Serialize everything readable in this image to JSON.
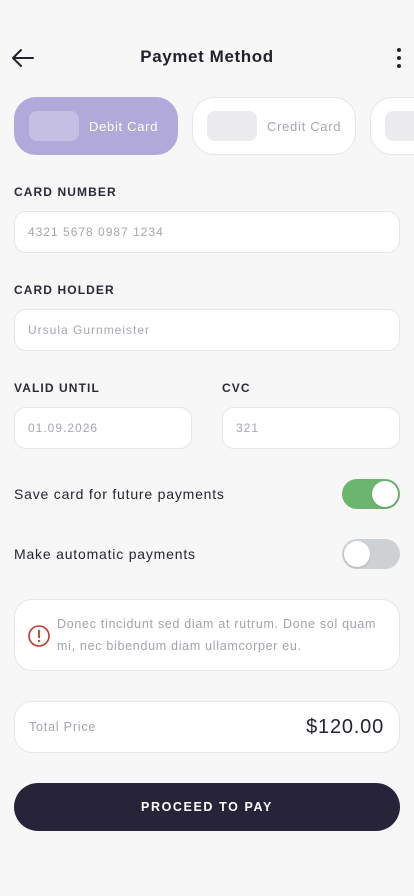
{
  "header": {
    "title": "Paymet Method"
  },
  "tabs": [
    {
      "label": "Debit Card",
      "active": true
    },
    {
      "label": "Credit Card",
      "active": false
    },
    {
      "label": "",
      "active": false
    }
  ],
  "form": {
    "card_number_label": "CARD NUMBER",
    "card_number_value": "4321 5678 0987 1234",
    "card_holder_label": "CARD HOLDER",
    "card_holder_value": "Ursula Gurnmeister",
    "valid_until_label": "VALID UNTIL",
    "valid_until_value": "01.09.2026",
    "cvc_label": "CVC",
    "cvc_value": "321"
  },
  "toggles": {
    "save_card_label": "Save card for future payments",
    "save_card_on": true,
    "auto_pay_label": "Make automatic payments",
    "auto_pay_on": false
  },
  "info": {
    "icon": "alert-circle-icon",
    "text": "Donec tincidunt sed diam at rutrum. Done sol quam mi, nec bibendum diam ullamcorper eu."
  },
  "total": {
    "label": "Total Price",
    "value": "$120.00"
  },
  "cta": {
    "label": "PROCEED TO PAY"
  },
  "colors": {
    "accent": "#b1a9d9",
    "toggle_on": "#6bb56f",
    "toggle_off": "#cdd1d4",
    "cta_bg": "#27243a",
    "alert": "#c0392b"
  }
}
